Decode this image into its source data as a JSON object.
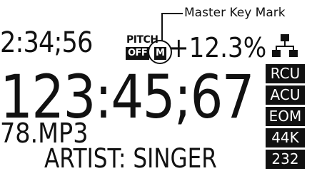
{
  "callout": {
    "label": "Master Key Mark"
  },
  "display": {
    "elapsed_time": "2:34;56",
    "main_time": "123:45;67",
    "filename": "78.MP3",
    "artist": "ARTIST: SINGER"
  },
  "pitch": {
    "label": "PITCH",
    "state": "OFF",
    "master_key": "M",
    "value": "+12.3%"
  },
  "status_badges": [
    "RCU",
    "ACU",
    "EOM",
    "44K",
    "232"
  ],
  "icons": {
    "network": "network-icon"
  }
}
